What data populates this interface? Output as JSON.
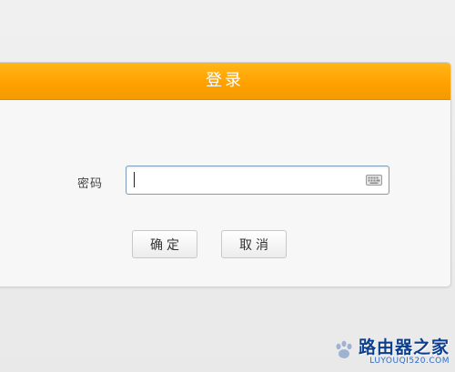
{
  "dialog": {
    "title": "登录",
    "password_label": "密码",
    "password_value": "",
    "ok_label": "确定",
    "cancel_label": "取消"
  },
  "icons": {
    "keyboard": "keyboard-icon",
    "watermark_logo": "baidu-paw-icon"
  },
  "watermark": {
    "main": "路由器之家",
    "sub": "LUYOUQI520.COM"
  },
  "colors": {
    "titlebar": "#ffa200",
    "title_text": "#ffffff",
    "input_border": "#7f9db9"
  }
}
